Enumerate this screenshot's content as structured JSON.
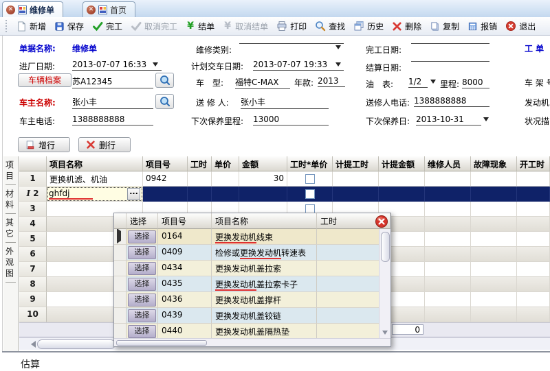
{
  "tabs": [
    {
      "label": "维修单",
      "active": true
    },
    {
      "label": "首页",
      "active": false
    }
  ],
  "toolbar": [
    {
      "label": "新增",
      "icon": "new-doc",
      "enabled": true
    },
    {
      "label": "保存",
      "icon": "save",
      "enabled": true
    },
    {
      "label": "完工",
      "icon": "check-green",
      "enabled": true
    },
    {
      "label": "取消完工",
      "icon": "check-gray",
      "enabled": false
    },
    {
      "label": "结单",
      "icon": "yen-green",
      "enabled": true
    },
    {
      "label": "取消结单",
      "icon": "yen-gray",
      "enabled": false
    },
    {
      "label": "打印",
      "icon": "printer",
      "enabled": true
    },
    {
      "label": "查找",
      "icon": "magnifier",
      "enabled": true
    },
    {
      "label": "历史",
      "icon": "history",
      "enabled": true
    },
    {
      "label": "删除",
      "icon": "delete-x",
      "enabled": true
    },
    {
      "label": "复制",
      "icon": "copy",
      "enabled": true
    },
    {
      "label": "报销",
      "icon": "calculator",
      "enabled": true
    },
    {
      "label": "退出",
      "icon": "exit",
      "enabled": true
    }
  ],
  "form": {
    "doc_name_label": "单据名称:",
    "doc_name_value": "维修单",
    "repair_type_label": "维修类别:",
    "finish_date_label": "完工日期:",
    "work_order_label": "工 单",
    "in_date_label": "进厂日期:",
    "in_date_value": "2013-07-07 16:33",
    "plan_date_label": "计划交车日期:",
    "plan_date_value": "2013-07-07 19:33",
    "settle_date_label": "结算日期:",
    "vehicle_btn": "车辆档案",
    "plate_value": "苏A12345",
    "model_label": "车　型:",
    "model_value": "福特C-MAX",
    "year_label": "年款:",
    "year_value": "2013",
    "fuel_label": "油　表:",
    "fuel_value": "1/2",
    "mileage_label": "里程:",
    "mileage_value": "8000",
    "vin_label": "车 架 号",
    "owner_label": "车主名称:",
    "owner_value": "张小丰",
    "sender_label": "送 修 人:",
    "sender_value": "张小丰",
    "sender_phone_label": "送修人电话:",
    "sender_phone_value": "1388888888",
    "engine_label": "发动机",
    "owner_phone_label": "车主电话:",
    "owner_phone_value": "1388888888",
    "next_mileage_label": "下次保养里程:",
    "next_mileage_value": "13000",
    "next_date_label": "下次保养日:",
    "next_date_value": "2013-10-31",
    "condition_label": "状况描"
  },
  "row_actions": {
    "add": "增行",
    "del": "删行"
  },
  "side_tabs": [
    "项目",
    "材料",
    "其它",
    "外观图"
  ],
  "grid": {
    "columns": [
      "项目名称",
      "项目号",
      "工时",
      "单价",
      "金额",
      "工时*单价",
      "计提工时",
      "计提金额",
      "维修人员",
      "故障现象",
      "开工时"
    ],
    "rows": [
      {
        "num": "1",
        "name": "更换机滤、机油",
        "code": "0942",
        "amount": "30"
      },
      {
        "num": "2",
        "name": "ghfdj",
        "editing": true
      },
      {
        "num": "3"
      },
      {
        "num": "4"
      },
      {
        "num": "5"
      },
      {
        "num": "6"
      },
      {
        "num": "7"
      },
      {
        "num": "8"
      },
      {
        "num": "9"
      },
      {
        "num": "10"
      }
    ],
    "footer_total": "0"
  },
  "popup": {
    "columns": [
      "选择",
      "项目号",
      "项目名称",
      "工时"
    ],
    "select_label": "选择",
    "rows": [
      {
        "code": "0164",
        "pre": "",
        "match": "更换发动机",
        "post": "线束"
      },
      {
        "code": "0409",
        "pre": "检修或",
        "match": "更换发动机",
        "post": "转速表"
      },
      {
        "code": "0434",
        "pre": "更换发动机盖拉索",
        "match": "",
        "post": ""
      },
      {
        "code": "0435",
        "pre": "",
        "match": "更换发动机",
        "post": "盖拉索卡子"
      },
      {
        "code": "0436",
        "pre": "更换发动机盖撑杆",
        "match": "",
        "post": ""
      },
      {
        "code": "0439",
        "pre": "更换发动机盖铰链",
        "match": "",
        "post": ""
      },
      {
        "code": "0440",
        "pre": "更换发动机盖隔热垫",
        "match": "",
        "post": ""
      }
    ]
  },
  "misc": {
    "bottom_partial": "估算"
  },
  "colors": {
    "selection_row": "#0f2268",
    "match_underline": "#e03030",
    "label_blue": "#0000cc",
    "label_red": "#cc0000",
    "popup_row_cream": "#f3f0da",
    "popup_row_blue": "#dbe8ef"
  }
}
